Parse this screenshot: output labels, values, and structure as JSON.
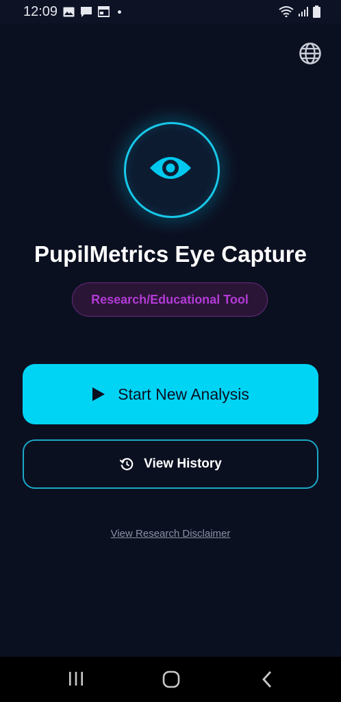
{
  "status_bar": {
    "time": "12:09"
  },
  "header": {
    "language_icon": "globe-icon"
  },
  "hero": {
    "icon": "eye-icon",
    "title": "PupilMetrics Eye Capture",
    "badge": "Research/Educational Tool"
  },
  "actions": {
    "start_label": "Start New Analysis",
    "start_icon": "play-icon",
    "history_label": "View History",
    "history_icon": "history-icon"
  },
  "footer": {
    "disclaimer_link": "View Research Disclaimer"
  },
  "colors": {
    "background": "#0b1021",
    "accent": "#00d4f5",
    "badge_text": "#b23bd6"
  }
}
